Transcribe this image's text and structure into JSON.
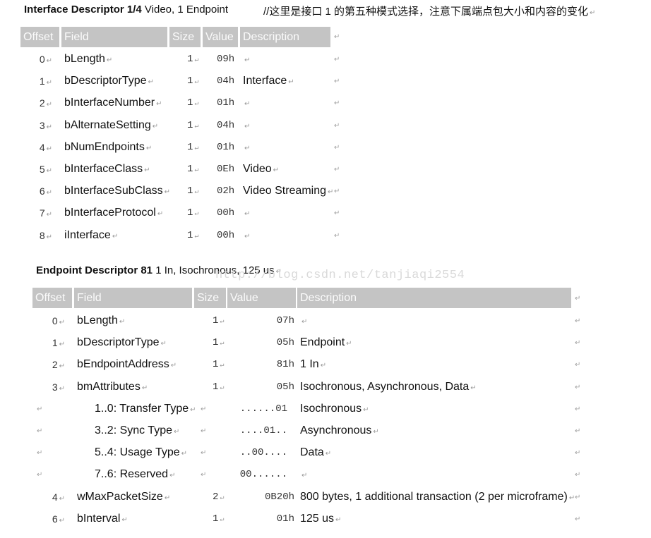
{
  "mark_glyph": "↵",
  "interface": {
    "title_bold": "Interface Descriptor 1/4",
    "title_rest": " Video, 1 Endpoint",
    "comment": "//这里是接口 1 的第五种模式选择，注意下属端点包大小和内容的变化",
    "headers": [
      "Offset",
      "Field",
      "Size",
      "Value",
      "Description"
    ],
    "rows": [
      {
        "offset": "0",
        "field": "bLength",
        "size": "1",
        "value": "09h",
        "description": ""
      },
      {
        "offset": "1",
        "field": "bDescriptorType",
        "size": "1",
        "value": "04h",
        "description": "Interface"
      },
      {
        "offset": "2",
        "field": "bInterfaceNumber",
        "size": "1",
        "value": "01h",
        "description": ""
      },
      {
        "offset": "3",
        "field": "bAlternateSetting",
        "size": "1",
        "value": "04h",
        "description": ""
      },
      {
        "offset": "4",
        "field": "bNumEndpoints",
        "size": "1",
        "value": "01h",
        "description": ""
      },
      {
        "offset": "5",
        "field": "bInterfaceClass",
        "size": "1",
        "value": "0Eh",
        "description": "Video"
      },
      {
        "offset": "6",
        "field": "bInterfaceSubClass",
        "size": "1",
        "value": "02h",
        "description": "Video Streaming"
      },
      {
        "offset": "7",
        "field": "bInterfaceProtocol",
        "size": "1",
        "value": "00h",
        "description": ""
      },
      {
        "offset": "8",
        "field": "iInterface",
        "size": "1",
        "value": "00h",
        "description": ""
      }
    ]
  },
  "endpoint": {
    "title_bold": "Endpoint Descriptor 81",
    "title_rest": " 1 In, Isochronous, 125 us",
    "watermark": "http://blog.csdn.net/tanjiaqi2554",
    "headers": [
      "Offset",
      "Field",
      "Size",
      "Value",
      "Description"
    ],
    "rows": [
      {
        "offset": "0",
        "field": "bLength",
        "size": "1",
        "value": "07h",
        "description": "",
        "sub": false
      },
      {
        "offset": "1",
        "field": "bDescriptorType",
        "size": "1",
        "value": "05h",
        "description": "Endpoint",
        "sub": false
      },
      {
        "offset": "2",
        "field": "bEndpointAddress",
        "size": "1",
        "value": "81h",
        "description": "1 In",
        "sub": false
      },
      {
        "offset": "3",
        "field": "bmAttributes",
        "size": "1",
        "value": "05h",
        "description": "Isochronous, Asynchronous, Data",
        "sub": false
      },
      {
        "offset": "",
        "field": "1..0: Transfer Type",
        "size": "",
        "value": "......01",
        "description": "Isochronous",
        "sub": true
      },
      {
        "offset": "",
        "field": "3..2: Sync Type",
        "size": "",
        "value": "....01..",
        "description": "Asynchronous",
        "sub": true
      },
      {
        "offset": "",
        "field": "5..4: Usage Type",
        "size": "",
        "value": "..00....",
        "description": "Data",
        "sub": true
      },
      {
        "offset": "",
        "field": "7..6: Reserved",
        "size": "",
        "value": "00......",
        "description": "",
        "sub": true
      },
      {
        "offset": "4",
        "field": "wMaxPacketSize",
        "size": "2",
        "value": "0B20h",
        "description": "800 bytes, 1 additional transaction (2 per microframe)",
        "sub": false
      },
      {
        "offset": "6",
        "field": "bInterval",
        "size": "1",
        "value": "01h",
        "description": "125 us",
        "sub": false
      }
    ]
  }
}
